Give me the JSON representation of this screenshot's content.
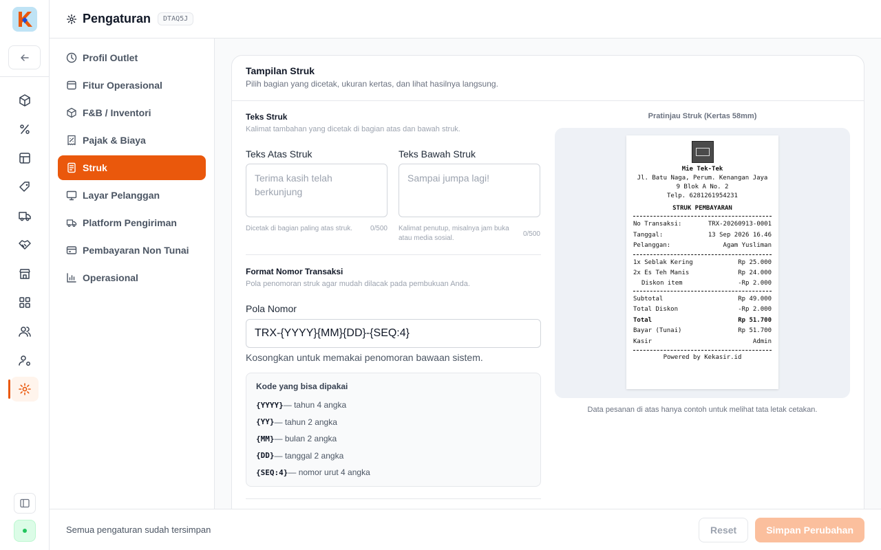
{
  "header": {
    "title": "Pengaturan",
    "badge": "DTAQ5J"
  },
  "menu": {
    "items": [
      {
        "label": "Profil Outlet",
        "icon": "clock-icon"
      },
      {
        "label": "Fitur Operasional",
        "icon": "box-icon"
      },
      {
        "label": "F&B / Inventori",
        "icon": "package-icon"
      },
      {
        "label": "Pajak & Biaya",
        "icon": "receipt-icon"
      },
      {
        "label": "Struk",
        "icon": "file-icon",
        "active": true
      },
      {
        "label": "Layar Pelanggan",
        "icon": "monitor-icon"
      },
      {
        "label": "Platform Pengiriman",
        "icon": "truck-icon"
      },
      {
        "label": "Pembayaran Non Tunai",
        "icon": "card-icon"
      },
      {
        "label": "Operasional",
        "icon": "chart-icon"
      }
    ]
  },
  "card": {
    "title": "Tampilan Struk",
    "subtitle": "Pilih bagian yang dicetak, ukuran kertas, dan lihat hasilnya langsung."
  },
  "teks": {
    "title": "Teks Struk",
    "desc": "Kalimat tambahan yang dicetak di bagian atas dan bawah struk.",
    "atas": {
      "label": "Teks Atas Struk",
      "placeholder": "Terima kasih telah berkunjung",
      "hint": "Dicetak di bagian paling atas struk.",
      "count": "0/500"
    },
    "bawah": {
      "label": "Teks Bawah Struk",
      "placeholder": "Sampai jumpa lagi!",
      "hint": "Kalimat penutup, misalnya jam buka atau media sosial.",
      "count": "0/500"
    }
  },
  "format": {
    "title": "Format Nomor Transaksi",
    "desc": "Pola penomoran struk agar mudah dilacak pada pembukuan Anda.",
    "label": "Pola Nomor",
    "value": "TRX-{YYYY}{MM}{DD}-{SEQ:4}",
    "hint": "Kosongkan untuk memakai penomoran bawaan sistem.",
    "codes_title": "Kode yang bisa dipakai",
    "codes": [
      {
        "code": "{YYYY}",
        "desc": " — tahun 4 angka"
      },
      {
        "code": "{YY}",
        "desc": " — tahun 2 angka"
      },
      {
        "code": "{MM}",
        "desc": " — bulan 2 angka"
      },
      {
        "code": "{DD}",
        "desc": " — tanggal 2 angka"
      },
      {
        "code": "{SEQ:4}",
        "desc": " — nomor urut 4 angka"
      }
    ]
  },
  "preview": {
    "label": "Pratinjau Struk (Kertas 58mm)",
    "note": "Data pesanan di atas hanya contoh untuk melihat tata letak cetakan.",
    "store_name": "Mie Tek-Tek",
    "address_1": "Jl. Batu Naga, Perum. Kenangan Jaya",
    "address_2": "9 Blok A No. 2",
    "phone": "Telp. 6281261954231",
    "heading": "STRUK PEMBAYARAN",
    "info": [
      {
        "k": "No Transaksi:",
        "v": "TRX-20260913-0001"
      },
      {
        "k": "Tanggal:",
        "v": "13 Sep 2026 16.46"
      },
      {
        "k": "Pelanggan:",
        "v": "Agam Yusliman"
      }
    ],
    "items": [
      {
        "k": "1x Seblak Kering",
        "v": "Rp 25.000"
      },
      {
        "k": "2x Es Teh Manis",
        "v": "Rp 24.000"
      }
    ],
    "item_discount": {
      "k": "Diskon item",
      "v": "-Rp 2.000"
    },
    "totals": [
      {
        "k": "Subtotal",
        "v": "Rp 49.000"
      },
      {
        "k": "Total Diskon",
        "v": "-Rp 2.000"
      }
    ],
    "total": {
      "k": "Total",
      "v": "Rp 51.700"
    },
    "payment": [
      {
        "k": "Bayar (Tunai)",
        "v": "Rp 51.700"
      },
      {
        "k": "Kasir",
        "v": "Admin"
      }
    ],
    "footer": "Powered by Kekasir.id"
  },
  "footer": {
    "message": "Semua pengaturan sudah tersimpan",
    "reset_label": "Reset",
    "save_label": "Simpan Perubahan"
  },
  "colors": {
    "accent": "#ea580c",
    "accent_disabled": "#fbbf9d"
  }
}
